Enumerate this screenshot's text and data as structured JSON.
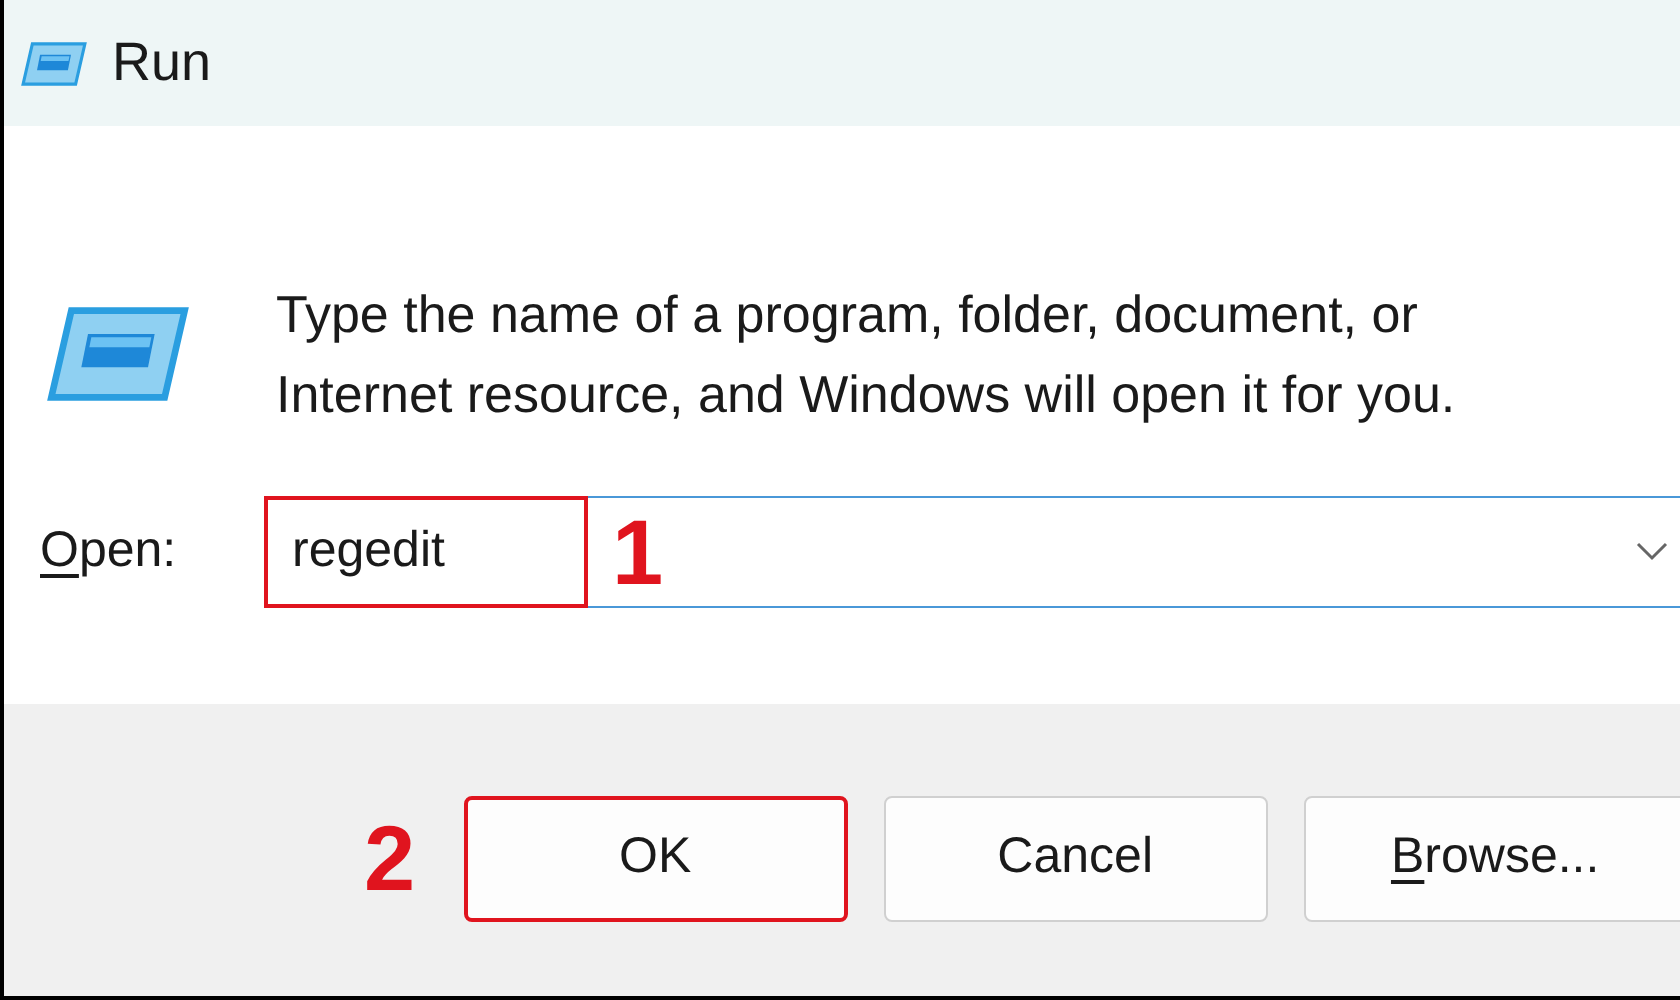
{
  "window": {
    "title": "Run"
  },
  "description": "Type the name of a program, folder, document, or Internet resource, and Windows will open it for you.",
  "open_field": {
    "label": "Open:",
    "label_mnemonic": true,
    "value": "regedit",
    "highlighted": true,
    "step": "1"
  },
  "buttons": [
    {
      "label": "OK",
      "mnemonic": false,
      "highlighted": true,
      "step": "2"
    },
    {
      "label": "Cancel",
      "mnemonic": false,
      "highlighted": false
    },
    {
      "label": "Browse...",
      "mnemonic": true,
      "highlighted": false
    }
  ]
}
